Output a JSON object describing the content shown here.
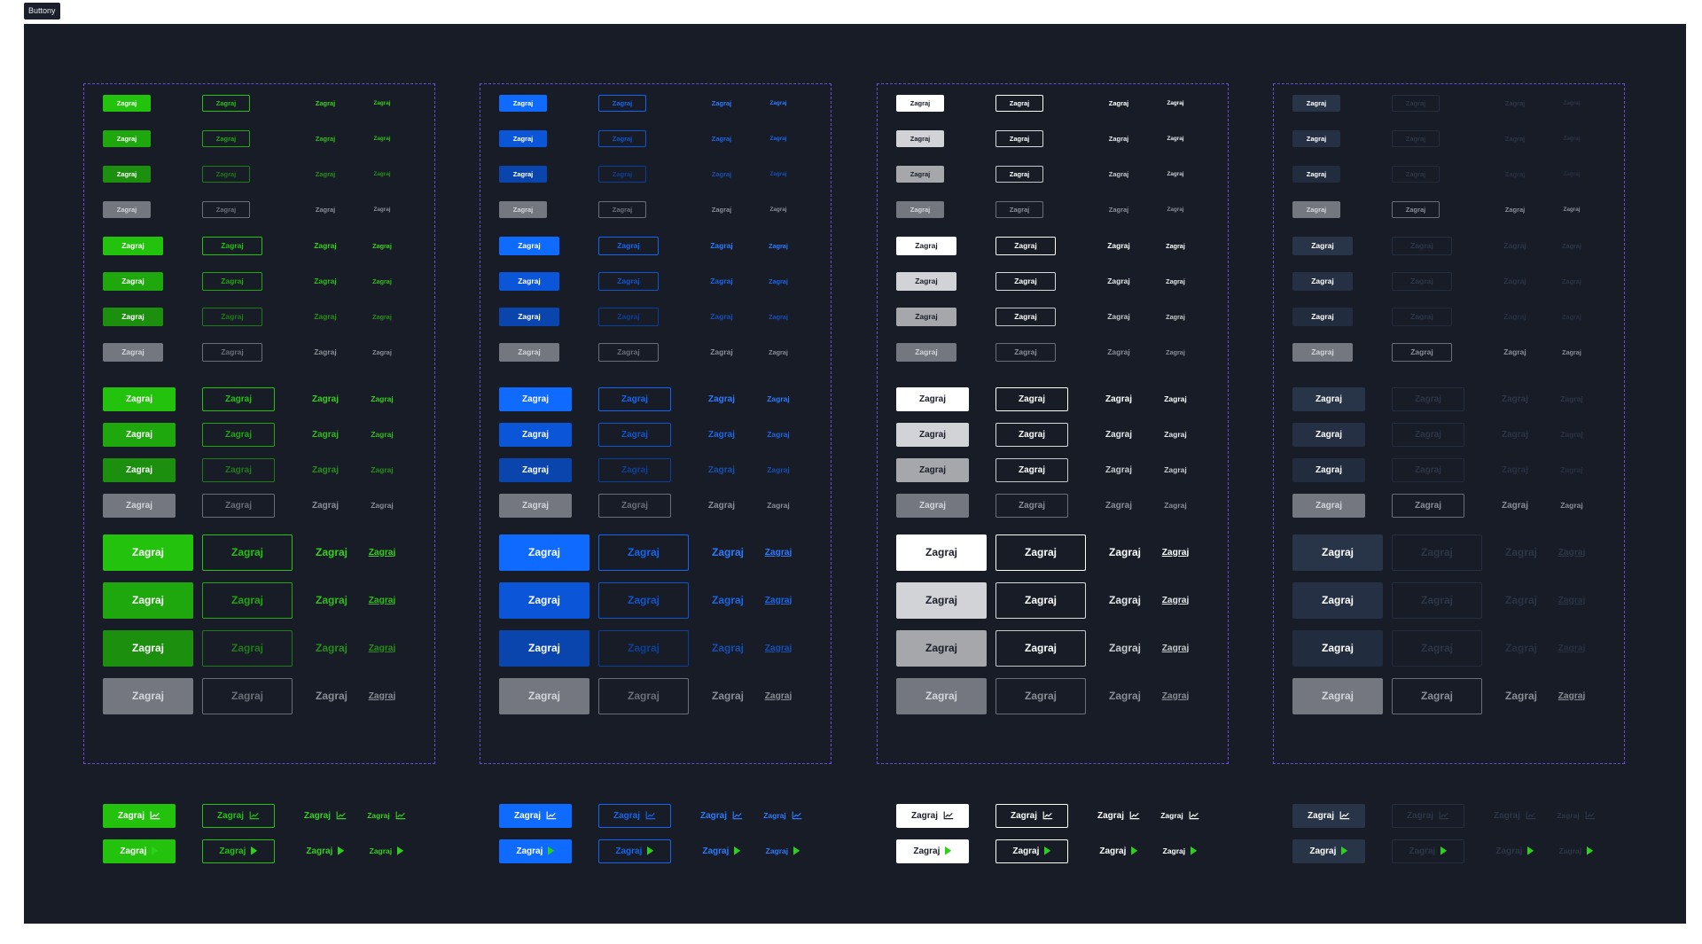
{
  "frame_label": "Buttony",
  "button_label": "Zagraj",
  "themes": [
    {
      "name": "green",
      "fill": [
        "#23c20d",
        "#1fa80d",
        "#1c8f0f",
        "#747780"
      ],
      "text": [
        "#ffffff",
        "#ffffff",
        "#ffffff",
        "#d3d5da"
      ],
      "outline": [
        "#23c20d",
        "#1fa80d",
        "#1f7a17",
        "#6b6e77"
      ],
      "ghost": [
        "#36d11b",
        "#2fbd19",
        "#278f18",
        "#8a8d95"
      ],
      "link": [
        "#36d11b",
        "#2fbd19",
        "#278f18",
        "#8a8d95"
      ],
      "accent": "#2bd11a"
    },
    {
      "name": "blue",
      "fill": [
        "#0f6bff",
        "#0b55d8",
        "#0a45ad",
        "#747780"
      ],
      "text": [
        "#ffffff",
        "#ffffff",
        "#ffffff",
        "#d3d5da"
      ],
      "outline": [
        "#1365f2",
        "#0f55d1",
        "#0c3f9a",
        "#6b6e77"
      ],
      "ghost": [
        "#2b7bff",
        "#1c66e6",
        "#164fb3",
        "#8a8d95"
      ],
      "link": [
        "#2b7bff",
        "#1c66e6",
        "#164fb3",
        "#8a8d95"
      ],
      "accent": "#2bd11a"
    },
    {
      "name": "white",
      "fill": [
        "#ffffff",
        "#d2d3d6",
        "#a6a7ab",
        "#747780"
      ],
      "text": [
        "#1a1f2b",
        "#1a1f2b",
        "#1a1f2b",
        "#d3d5da"
      ],
      "outline": [
        "#ffffff",
        "#d8d9dc",
        "#c5c6ca",
        "#6b6e77"
      ],
      "ghost": [
        "#ffffff",
        "#e6e7ea",
        "#c8c9cd",
        "#8a8d95"
      ],
      "link": [
        "#ffffff",
        "#e6e7ea",
        "#c8c9cd",
        "#8a8d95"
      ],
      "accent": "#2bd11a"
    },
    {
      "name": "navy",
      "fill": [
        "#283448",
        "#253044",
        "#222c3f",
        "#747780"
      ],
      "text": [
        "#ffffff",
        "#ffffff",
        "#ffffff",
        "#d3d5da"
      ],
      "outline": [
        "#262f40",
        "#252e3e",
        "#232b3b",
        "#6b6e77"
      ],
      "ghost": [
        "#2d3646",
        "#2b3444",
        "#283141",
        "#8a8d95"
      ],
      "link": [
        "#2d3646",
        "#2b3444",
        "#283141",
        "#8a8d95"
      ],
      "accent": "#2bd11a"
    }
  ],
  "sizes": [
    {
      "fill_w": 54,
      "fill_h": 19,
      "out_w": 54,
      "out_h": 19,
      "font": 7.5,
      "pitch": 40
    },
    {
      "fill_w": 68,
      "fill_h": 21,
      "out_w": 68,
      "out_h": 21,
      "font": 8.5,
      "pitch": 40
    },
    {
      "fill_w": 82,
      "fill_h": 27,
      "out_w": 82,
      "out_h": 27,
      "font": 10,
      "pitch": 40
    },
    {
      "fill_w": 102,
      "fill_h": 41,
      "out_w": 102,
      "out_h": 41,
      "font": 12,
      "pitch": 54
    }
  ],
  "icon_rows": [
    {
      "icon": "chart-icon"
    },
    {
      "icon": "play-icon"
    }
  ]
}
